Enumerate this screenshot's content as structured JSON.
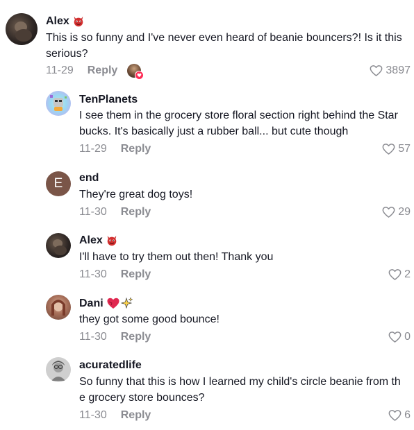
{
  "comments": [
    {
      "username": "Alex",
      "text": "This is so funny and I've never even heard of beanie bouncers?! Is it this\nserious?",
      "date": "11-29",
      "reply_label": "Reply",
      "likes": "3897",
      "badge_icon": "devil-icon",
      "creator_liked": true
    },
    {
      "username": "TenPlanets",
      "text": "I see them in the grocery store floral section right behind the Star\nbucks. It's basically just a rubber ball... but cute though",
      "date": "11-29",
      "reply_label": "Reply",
      "likes": "57"
    },
    {
      "username": "end",
      "avatar_letter": "E",
      "text": "They're great dog toys!",
      "date": "11-30",
      "reply_label": "Reply",
      "likes": "29"
    },
    {
      "username": "Alex",
      "text": "I'll have to try them out then! Thank you",
      "date": "11-30",
      "reply_label": "Reply",
      "likes": "2",
      "badge_icon": "devil-icon"
    },
    {
      "username": "Dani",
      "text": "they got some good bounce!",
      "date": "11-30",
      "reply_label": "Reply",
      "likes": "0",
      "badge_icon": "heart-sparkle-icon"
    },
    {
      "username": "acuratedlife",
      "text": "So funny that this is how I learned my child's circle beanie from th\ne grocery store bounces?",
      "date": "11-30",
      "reply_label": "Reply",
      "likes": "6"
    }
  ],
  "colors": {
    "text": "#161823",
    "muted": "#8a8b91",
    "like_outline": "#8a8b91",
    "creator_heart": "#fe2c55"
  }
}
